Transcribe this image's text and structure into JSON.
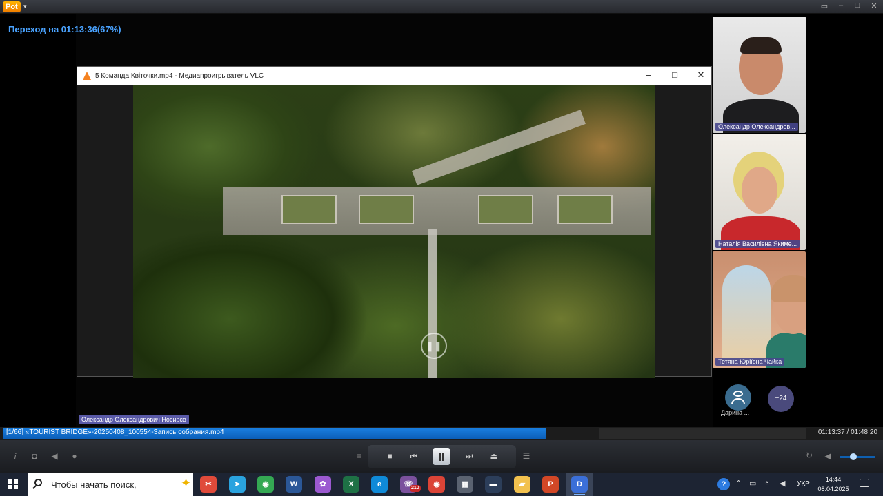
{
  "potplayer": {
    "seek_osd": "Переход на 01:13:36(67%)",
    "now_playing": "[1/66] «TOURIST BRIDGE»-20250408_100554-Запись собрания.mp4",
    "time": "01:13:37 / 01:48:20",
    "progress_fraction": 0.677
  },
  "vlc": {
    "title": "5 Команда Квіточки.mp4 - Медиапроигрыватель VLC"
  },
  "meeting": {
    "speaker_label": "Олександр Олександрович Носирєв",
    "participants": [
      {
        "name": "Олександр Олександров..."
      },
      {
        "name": "Наталія Василівна Якиме..."
      },
      {
        "name": "Тетяна Юріївна Чайка"
      }
    ],
    "avatar_participant": "Дарина ...",
    "more_count": "+24"
  },
  "taskbar": {
    "search_placeholder": "Чтобы начать поиск,",
    "language": "УКР",
    "clock_time": "14:44",
    "clock_date": "08.04.2025",
    "viber_badge": "210",
    "apps": [
      {
        "icon": "snipping-tool-icon",
        "color": "#e04a3a"
      },
      {
        "icon": "telegram-icon",
        "color": "#2aa3df"
      },
      {
        "icon": "chrome-icon",
        "color": "#34a853"
      },
      {
        "icon": "word-icon",
        "color": "#2b5797"
      },
      {
        "icon": "copilot-icon",
        "color": "#9b59d0"
      },
      {
        "icon": "excel-icon",
        "color": "#1e7145"
      },
      {
        "icon": "edge-icon",
        "color": "#0f8ad8"
      },
      {
        "icon": "viber-icon",
        "color": "#7b519d"
      },
      {
        "icon": "chrome-profile-icon",
        "color": "#db4437"
      },
      {
        "icon": "calculator-icon",
        "color": "#5a6270"
      },
      {
        "icon": "tv-app-icon",
        "color": "#2c3e5a"
      },
      {
        "icon": "file-explorer-icon",
        "color": "#f2c14e"
      },
      {
        "icon": "powerpoint-icon",
        "color": "#d24726"
      },
      {
        "icon": "potplayer-icon",
        "color": "#3b6fd8"
      }
    ]
  }
}
